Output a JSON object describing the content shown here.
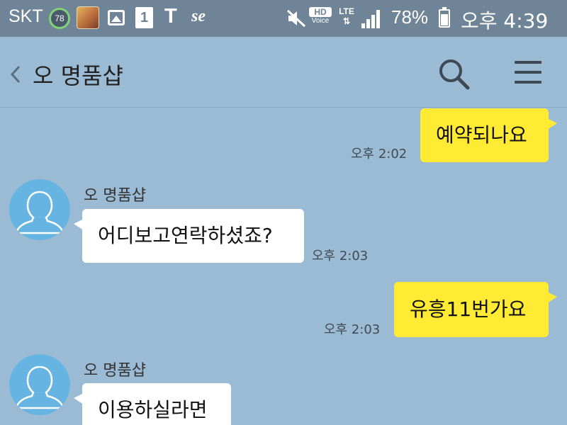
{
  "status_bar": {
    "carrier": "SKT",
    "badge_count": "78",
    "app_icon": "netmarble-app-icon",
    "icons": [
      "gallery-icon",
      "number-one-icon",
      "t-icon",
      "se-icon",
      "mute-icon",
      "hd-voice-icon",
      "lte-icon",
      "signal-icon",
      "battery-icon"
    ],
    "t_label": "T",
    "se_label": "se",
    "one_label": "1",
    "hd_label": "HD",
    "voice_label": "Voice",
    "lte_label": "LTE",
    "battery_percent": "78%",
    "time": "오후 4:39"
  },
  "header": {
    "title": "오 명품샵",
    "icons": [
      "back-chevron-icon",
      "search-icon",
      "menu-icon"
    ]
  },
  "messages": [
    {
      "from": "me",
      "text": "예약되나요",
      "time": "오후 2:02"
    },
    {
      "from": "other",
      "sender": "오 명품샵",
      "text": "어디보고연락하셨죠?",
      "time": "오후 2:03"
    },
    {
      "from": "me",
      "text": "유흥11번가요",
      "time": "오후 2:03"
    },
    {
      "from": "other",
      "sender": "오 명품샵",
      "text": "이용하실라면",
      "time": ""
    }
  ],
  "colors": {
    "background": "#9bbbd4",
    "status_bar": "#6f8497",
    "my_bubble": "#ffeb33",
    "their_bubble": "#ffffff",
    "avatar": "#65b4e2"
  }
}
